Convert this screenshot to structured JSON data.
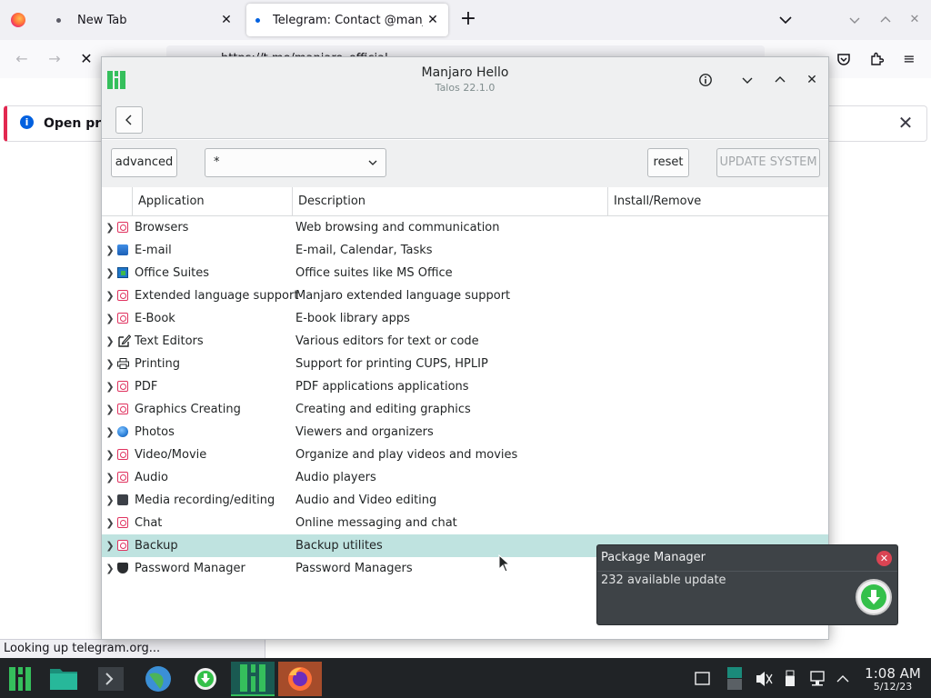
{
  "firefox": {
    "tabs": [
      {
        "label": "New Tab"
      },
      {
        "label": "Telegram: Contact @manjaro_official"
      }
    ],
    "url": "https://t.me/manjaro_official",
    "infobar_text": "Open previous windows and tabs?",
    "status_text": "Looking up telegram.org..."
  },
  "manjaro_hello": {
    "title": "Manjaro Hello",
    "subtitle": "Talos 22.1.0",
    "toolbar": {
      "advanced_label": "advanced",
      "filter_value": "*",
      "reset_label": "reset",
      "update_label": "UPDATE SYSTEM"
    },
    "columns": {
      "application": "Application",
      "description": "Description",
      "install": "Install/Remove"
    },
    "rows": [
      {
        "app": "Browsers",
        "desc": "Web browsing and communication",
        "icon": "missing-image-icon"
      },
      {
        "app": "E-mail",
        "desc": "E-mail, Calendar, Tasks",
        "icon": "mail-icon"
      },
      {
        "app": "Office Suites",
        "desc": "Office suites like MS Office",
        "icon": "office-icon"
      },
      {
        "app": "Extended language support",
        "desc": "Manjaro extended language support",
        "icon": "missing-image-icon"
      },
      {
        "app": "E-Book",
        "desc": "E-book library apps",
        "icon": "missing-image-icon"
      },
      {
        "app": "Text Editors",
        "desc": "Various editors for text or code",
        "icon": "edit-icon"
      },
      {
        "app": "Printing",
        "desc": "Support for printing CUPS, HPLIP",
        "icon": "printer-icon"
      },
      {
        "app": "PDF",
        "desc": "PDF applications applications",
        "icon": "missing-image-icon"
      },
      {
        "app": "Graphics Creating",
        "desc": "Creating and editing graphics",
        "icon": "missing-image-icon"
      },
      {
        "app": "Photos",
        "desc": "Viewers and organizers",
        "icon": "photos-icon"
      },
      {
        "app": "Video/Movie",
        "desc": "Organize and play videos and movies",
        "icon": "missing-image-icon"
      },
      {
        "app": "Audio",
        "desc": "Audio players",
        "icon": "missing-image-icon"
      },
      {
        "app": "Media recording/editing",
        "desc": "Audio and Video editing",
        "icon": "media-icon"
      },
      {
        "app": "Chat",
        "desc": "Online messaging and chat",
        "icon": "missing-image-icon"
      },
      {
        "app": "Backup",
        "desc": "Backup utilites",
        "icon": "missing-image-icon",
        "selected": true
      },
      {
        "app": "Password Manager",
        "desc": "Password Managers",
        "icon": "shield-icon"
      }
    ]
  },
  "notification": {
    "title": "Package Manager",
    "body": "232 available update"
  },
  "taskbar": {
    "time": "1:08 AM",
    "date": "5/12/23"
  },
  "colors": {
    "accent": "#35bf5c",
    "selection": "#bfe3e0",
    "taskbar": "#202326",
    "notification_bg": "#3e4347",
    "close_red": "#da4453"
  }
}
